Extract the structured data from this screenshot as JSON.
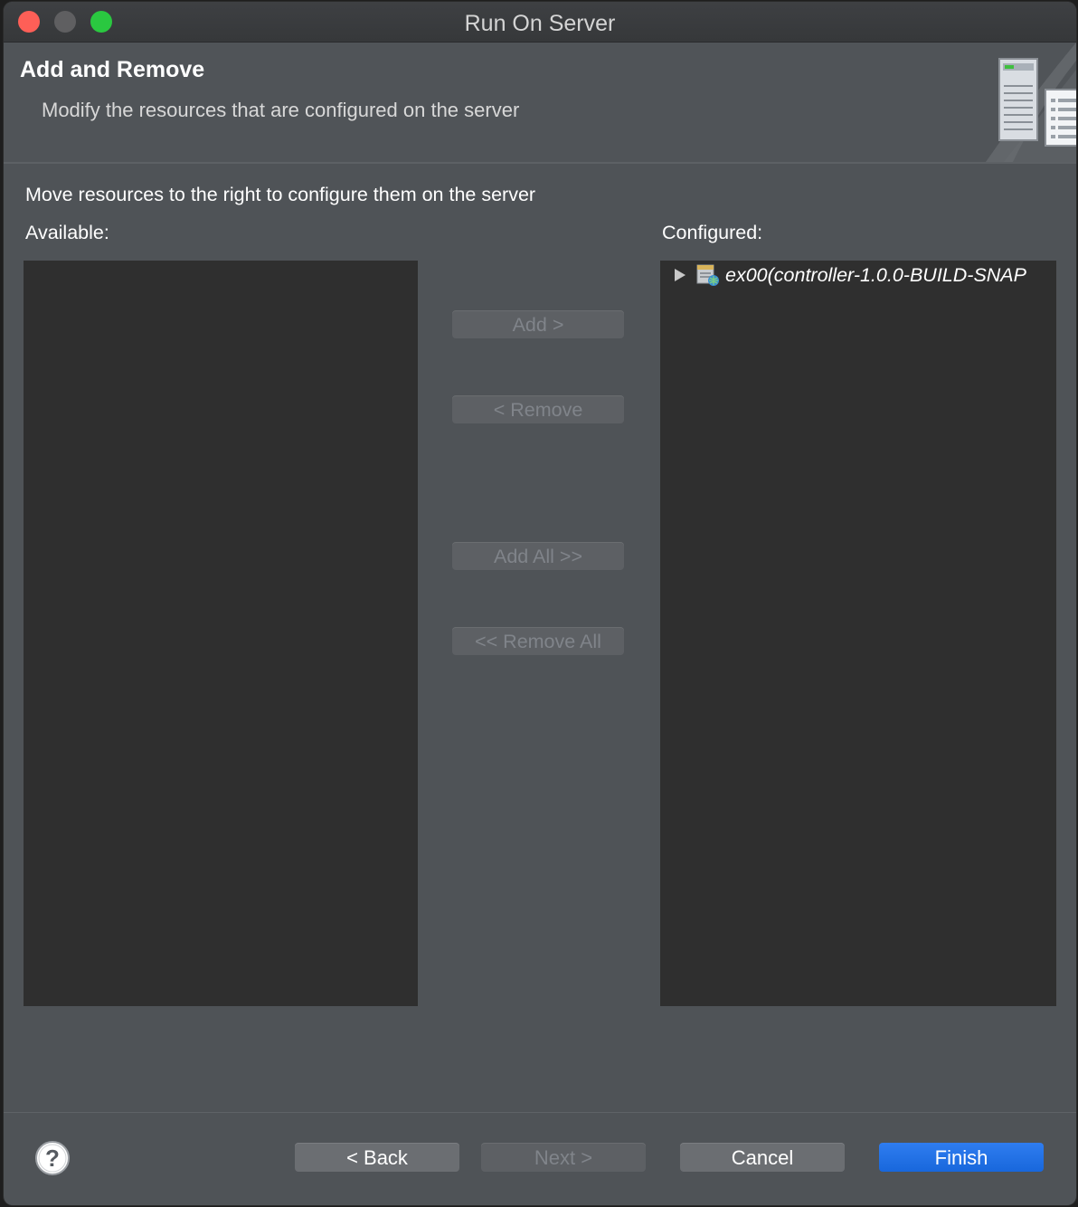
{
  "window": {
    "title": "Run On Server"
  },
  "header": {
    "title": "Add and Remove",
    "description": "Modify the resources that are configured on the server",
    "banner_icon": "server-wizard-banner-icon"
  },
  "instruction": "Move resources to the right to configure them on the server",
  "available": {
    "label": "Available:",
    "items": []
  },
  "configured": {
    "label": "Configured:",
    "items": [
      {
        "label": "ex00(controller-1.0.0-BUILD-SNAP",
        "icon": "web-module-icon",
        "expanded": false
      }
    ]
  },
  "middle_buttons": {
    "add": "Add >",
    "remove": "< Remove",
    "add_all": "Add All >>",
    "remove_all": "<< Remove All"
  },
  "footer": {
    "help_icon": "help-icon",
    "back": "< Back",
    "next": "Next >",
    "cancel": "Cancel",
    "finish": "Finish"
  },
  "colors": {
    "close": "#fe5f57",
    "minimize": "#5f5f61",
    "maximize": "#2ac840",
    "primary": "#1867dc",
    "list_bg": "#2f2f2f",
    "dialog_bg": "#4f5357"
  }
}
